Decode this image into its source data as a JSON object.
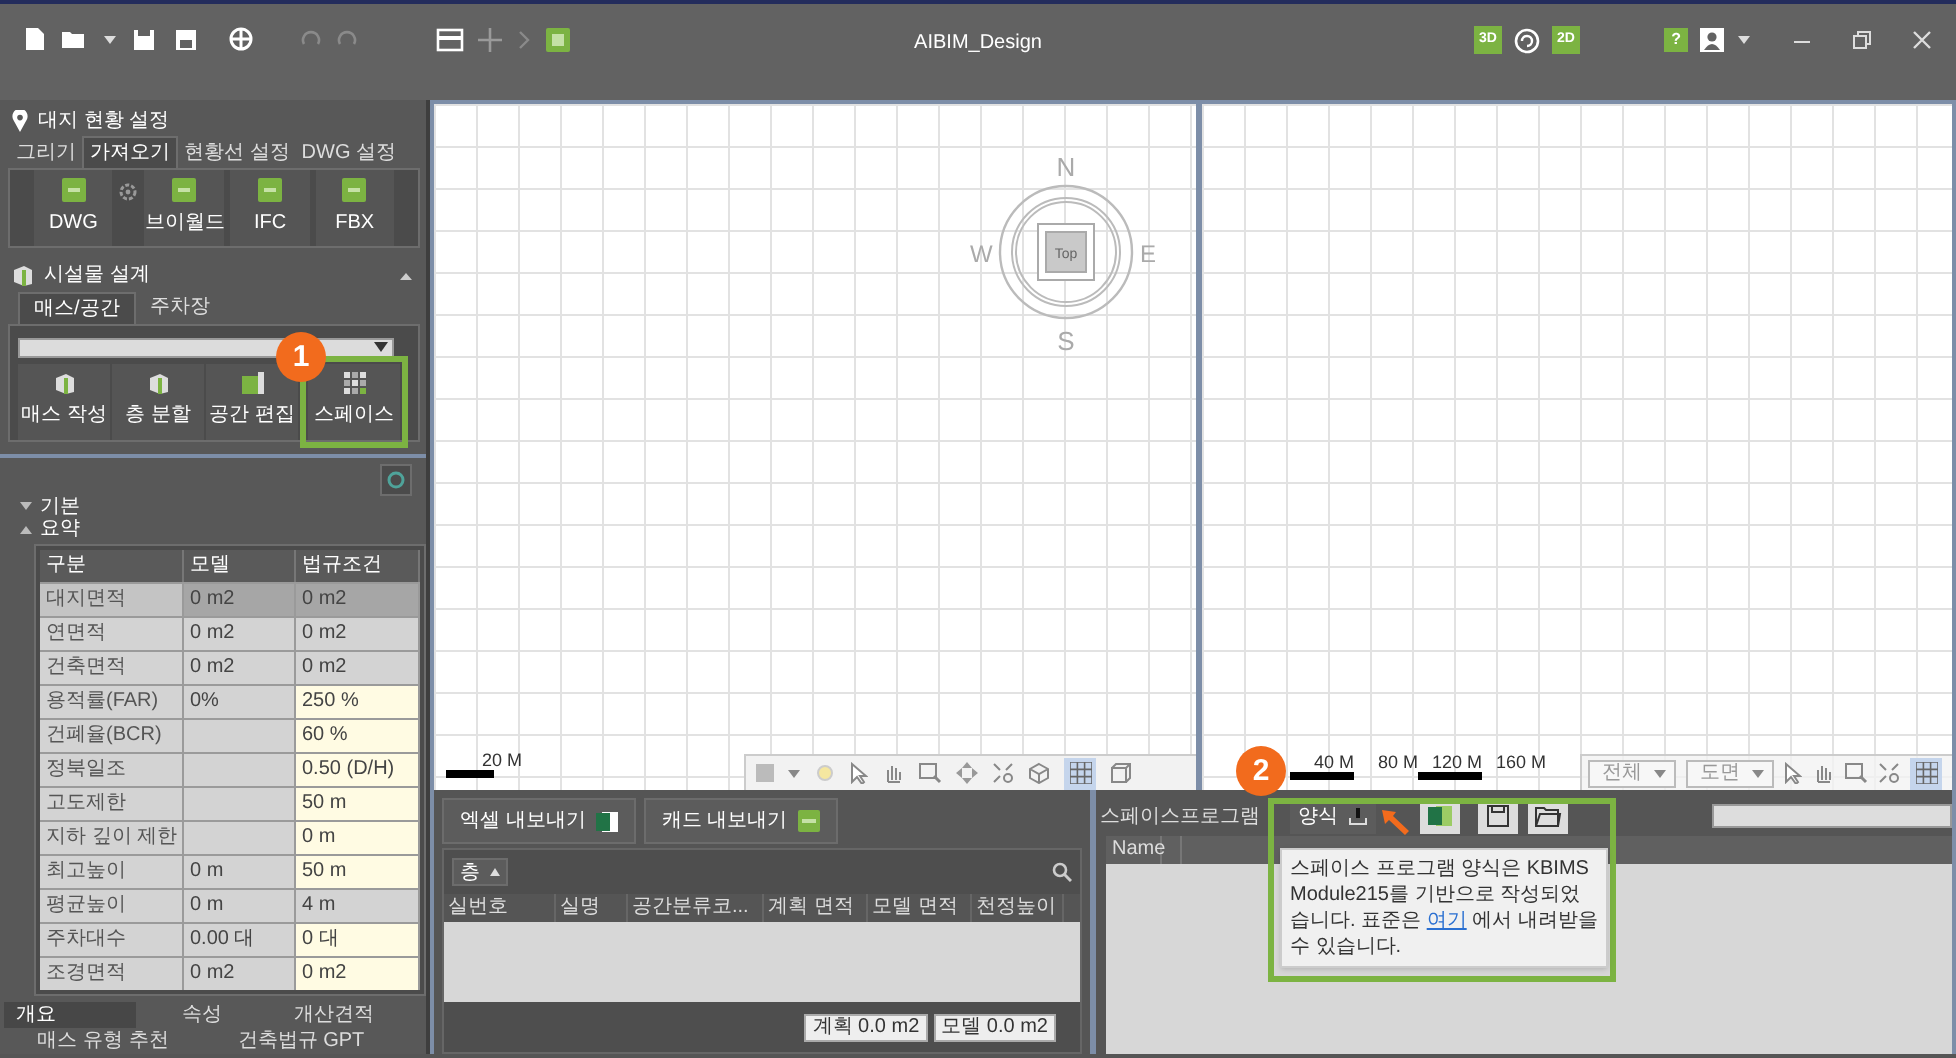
{
  "window": {
    "title": "AIBIM_Design",
    "view_buttons": [
      "3D",
      "2D"
    ],
    "help": "?"
  },
  "site_setup": {
    "title": "대지 현황 설정",
    "tabs": [
      {
        "label": "그리기",
        "selected": false
      },
      {
        "label": "가져오기",
        "selected": true
      },
      {
        "label": "현황선 설정",
        "selected": false
      },
      {
        "label": "DWG 설정",
        "selected": false
      }
    ],
    "buttons": [
      "DWG",
      "브이월드",
      "IFC",
      "FBX"
    ]
  },
  "facility_design": {
    "title": "시설물 설계",
    "expanded": true,
    "tabs": [
      {
        "label": "매스/공간",
        "selected": true
      },
      {
        "label": "주차장",
        "selected": false
      }
    ],
    "buttons": [
      "매스 작성",
      "층 분할",
      "공간 편집",
      "스페이스"
    ]
  },
  "summary": {
    "sections": [
      {
        "label": "기본",
        "expanded": false
      },
      {
        "label": "요약",
        "expanded": true
      }
    ],
    "columns": [
      "구분",
      "모델",
      "법규조건"
    ],
    "rows": [
      {
        "cells": [
          "대지면적",
          "0 m2",
          "0 m2"
        ],
        "selected": true,
        "editable": false
      },
      {
        "cells": [
          "연면적",
          "0 m2",
          "0 m2"
        ],
        "selected": false,
        "editable": false
      },
      {
        "cells": [
          "건축면적",
          "0 m2",
          "0 m2"
        ],
        "selected": false,
        "editable": false
      },
      {
        "cells": [
          "용적률(FAR)",
          "0%",
          "250 %"
        ],
        "selected": false,
        "editable": true
      },
      {
        "cells": [
          "건폐율(BCR)",
          "",
          "60 %"
        ],
        "selected": false,
        "editable": true
      },
      {
        "cells": [
          "정북일조",
          "",
          "0.50 (D/H)"
        ],
        "selected": false,
        "editable": true
      },
      {
        "cells": [
          "고도제한",
          "",
          "50 m"
        ],
        "selected": false,
        "editable": true
      },
      {
        "cells": [
          "지하 깊이 제한",
          "",
          "0 m"
        ],
        "selected": false,
        "editable": true
      },
      {
        "cells": [
          "최고높이",
          "0 m",
          "50 m"
        ],
        "selected": false,
        "editable": true
      },
      {
        "cells": [
          "평균높이",
          "0 m",
          "4 m"
        ],
        "selected": false,
        "editable": false
      },
      {
        "cells": [
          "주차대수",
          "0.00 대",
          "0 대"
        ],
        "selected": false,
        "editable": true
      },
      {
        "cells": [
          "조경면적",
          "0 m2",
          "0 m2"
        ],
        "selected": false,
        "editable": true
      }
    ]
  },
  "bottom_tabs": [
    {
      "label": "개요",
      "selected": true
    },
    {
      "label": "속성",
      "selected": false
    },
    {
      "label": "개산견적",
      "selected": false
    }
  ],
  "extra_tabs": [
    {
      "label": "매스 유형 추천",
      "selected": false
    },
    {
      "label": "건축법규 GPT",
      "selected": false
    }
  ],
  "plan_view": {
    "compass": {
      "north": "N",
      "east": "E",
      "south": "S",
      "west": "W",
      "center": "Top"
    },
    "scale_labels": [
      "20 M"
    ]
  },
  "section_view": {
    "scale_labels": [
      "40 M",
      "80 M",
      "120 M",
      "160 M"
    ],
    "dropdowns": [
      "전체",
      "도면"
    ]
  },
  "export_panel": {
    "buttons": [
      "엑셀 내보내기",
      "캐드 내보내기"
    ],
    "floor_filter": "층",
    "columns": [
      "실번호",
      "실명",
      "공간분류코...",
      "계획 면적",
      "모델 면적",
      "천정높이"
    ],
    "totals": [
      "계획 0.0 m2",
      "모델 0.0 m2"
    ]
  },
  "space_program": {
    "title": "스페이스프로그램",
    "form_button": "양식",
    "columns": [
      "Name"
    ],
    "tooltip": {
      "message": "스페이스 프로그램 양식은 KBIMS Module215를 기반으로 작성되었습니다. 표준은",
      "link": "여기",
      "message_end": "에서 내려받을 수 있습니다."
    }
  },
  "callouts": [
    "1",
    "2"
  ]
}
